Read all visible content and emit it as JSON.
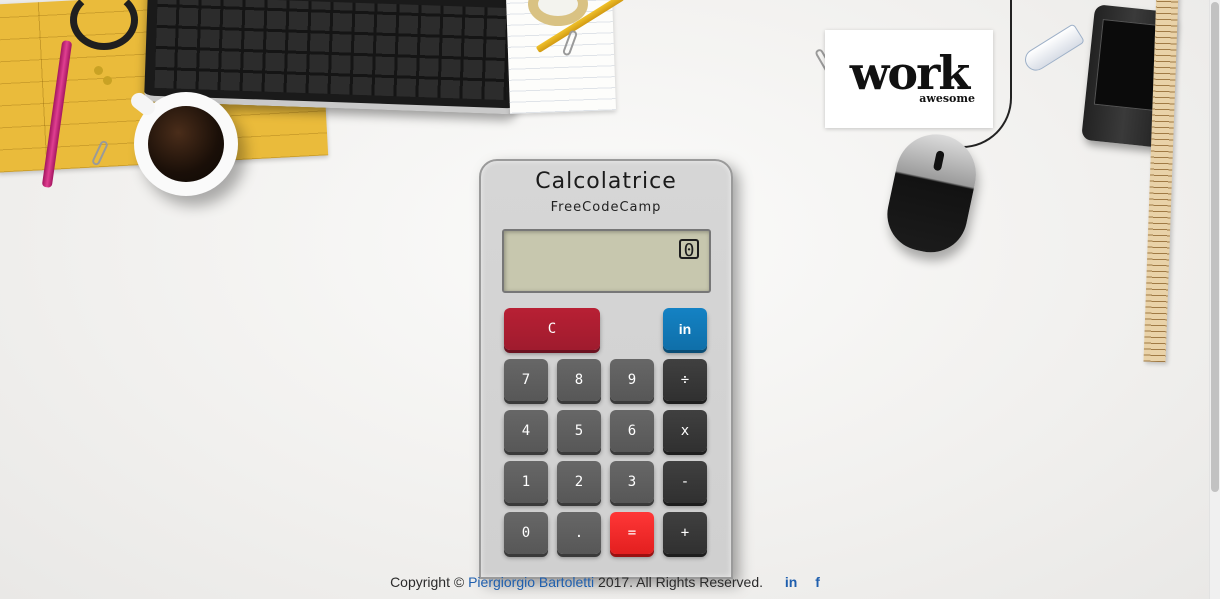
{
  "calculator": {
    "title": "Calcolatrice",
    "subtitle": "FreeCodeCamp",
    "display_value": "0",
    "clear_label": "C",
    "linkedin_label": "in",
    "keys": {
      "k7": "7",
      "k8": "8",
      "k9": "9",
      "div": "÷",
      "k4": "4",
      "k5": "5",
      "k6": "6",
      "mul": "x",
      "k1": "1",
      "k2": "2",
      "k3": "3",
      "sub": "-",
      "k0": "0",
      "dot": ".",
      "eq": "=",
      "add": "+"
    }
  },
  "desk": {
    "card_word": "work",
    "card_subword": "awesome"
  },
  "footer": {
    "copyright_prefix": "Copyright ©",
    "author": "Piergiorgio Bartoletti",
    "copyright_suffix": "2017. All Rights Reserved.",
    "linkedin_icon_label": "in",
    "facebook_icon_label": "f"
  },
  "colors": {
    "clear_key": "#9f1b2e",
    "equals_key": "#e31f1f",
    "linkedin_key": "#0f6fa9",
    "operator_key": "#303030",
    "digit_key": "#575757",
    "display_bg": "#c7c7ae",
    "link": "#1f5fae"
  }
}
